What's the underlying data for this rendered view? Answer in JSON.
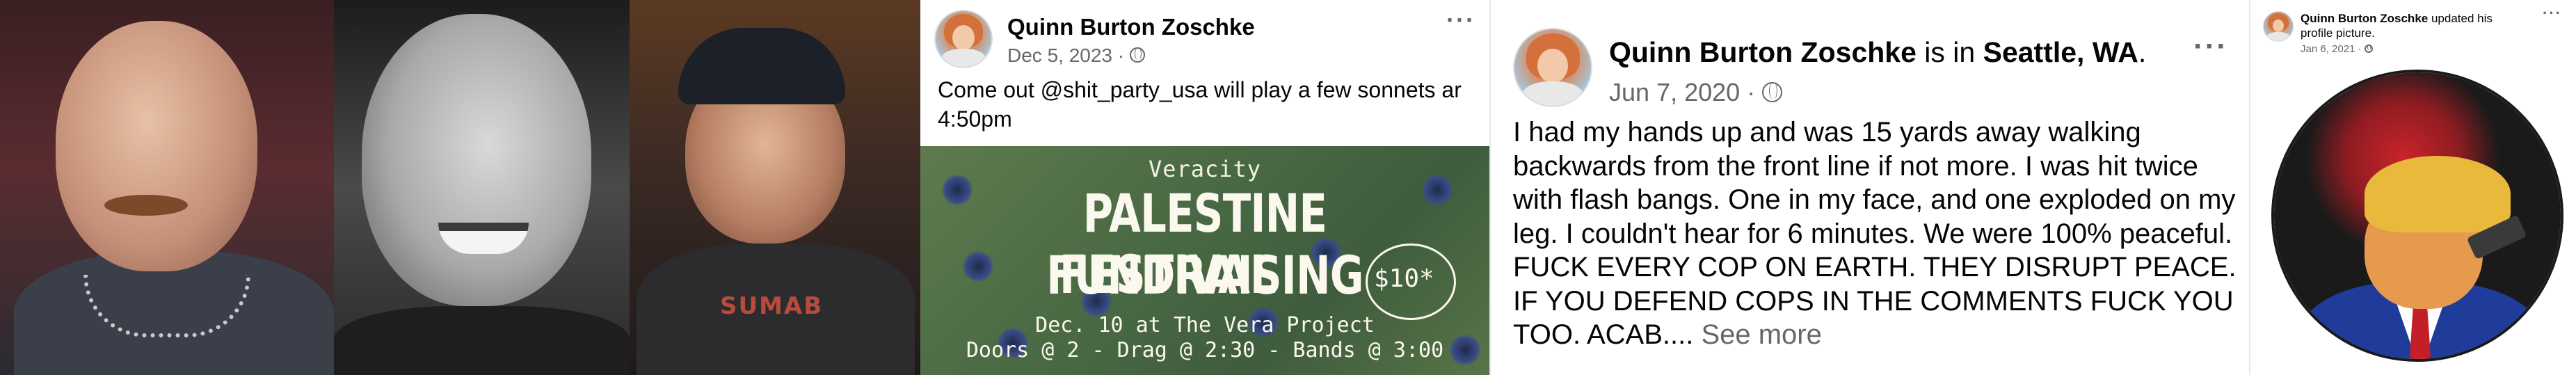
{
  "photos": [
    {
      "alt": "man with mustache and chain necklace"
    },
    {
      "alt": "black and white photo of smiling man with mustache"
    },
    {
      "alt": "man in cap smiling",
      "shirt_text": "SUMAB"
    }
  ],
  "post1": {
    "author": "Quinn Burton Zoschke",
    "date": "Dec 5, 2023 ·",
    "menu": "···",
    "text": "Come out @shit_party_usa will play a few sonnets ar 4:50pm",
    "flyer": {
      "venue": "Veracity",
      "title_line1": "PALESTINE FUNDRAISING",
      "title_line2": "FESTIVAL",
      "price": "$10*",
      "line1": "Dec. 10 at The Vera Project",
      "line2": "Doors @ 2 - Drag @ 2:30 - Bands @ 3:00"
    }
  },
  "post2": {
    "author": "Quinn Burton Zoschke",
    "is_in": " is in ",
    "location": "Seattle, WA",
    "period": ".",
    "date": "Jun 7, 2020 ·",
    "menu": "···",
    "text": "I had my hands up and was 15 yards away walking backwards from the front line if not more. I was hit twice with flash bangs. One in my face, and one exploded on my leg. I couldn't hear for 6 minutes. We were 100% peaceful. FUCK EVERY COP ON EARTH. THEY DISRUPT PEACE. IF YOU DEFEND COPS IN THE COMMENTS FUCK YOU TOO. ACAB.... ",
    "see_more": "See more"
  },
  "post3": {
    "author": "Quinn Burton Zoschke",
    "action": " updated his profile picture.",
    "date": "Jan 6, 2021 ·",
    "menu": "···"
  },
  "colors": {
    "text_primary": "#050505",
    "text_secondary": "#65676b",
    "flyer_green": "#4a6a44",
    "suit_blue": "#1f3c9a",
    "tie_red": "#c41e26"
  }
}
